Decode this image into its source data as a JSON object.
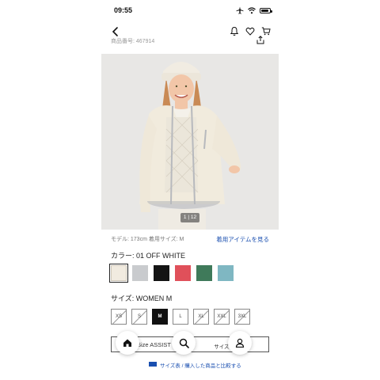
{
  "status_bar": {
    "time": "09:55",
    "icons": [
      "airplane-icon",
      "wifi-icon",
      "battery-icon"
    ]
  },
  "header": {
    "back_icon": "chevron-left-icon",
    "icons": [
      "bell-icon",
      "heart-icon",
      "cart-icon",
      "share-icon"
    ],
    "product_number": "商品番号: 467914"
  },
  "product_image": {
    "description_icon": "product-photo",
    "counter": "1 | 12"
  },
  "model_info": "モデル: 173cm 着用サイズ: M",
  "coordinate_link": "着用アイテムを見る",
  "color": {
    "label": "カラー: 01 OFF WHITE",
    "swatches": [
      {
        "color": "#f1ebe0",
        "selected": true
      },
      {
        "color": "#c9cbce",
        "selected": false
      },
      {
        "color": "#141414",
        "selected": false
      },
      {
        "color": "#e0505a",
        "selected": false
      },
      {
        "color": "#3f7a5a",
        "selected": false
      },
      {
        "color": "#7fb7c2",
        "selected": false
      }
    ]
  },
  "size": {
    "label": "サイズ: WOMEN M",
    "options": [
      {
        "label": "XS",
        "state": "unavailable"
      },
      {
        "label": "S",
        "state": "unavailable"
      },
      {
        "label": "M",
        "state": "selected"
      },
      {
        "label": "L",
        "state": "available"
      },
      {
        "label": "XL",
        "state": "unavailable"
      },
      {
        "label": "XXL",
        "state": "unavailable"
      },
      {
        "label": "3XL",
        "state": "unavailable"
      }
    ]
  },
  "assist_bar": {
    "left_text": "Size ASSIST",
    "right_text": "サイズを確認"
  },
  "floating_nav": {
    "icons": [
      "home-icon",
      "search-icon",
      "account-icon"
    ]
  },
  "size_chart_link": "サイズ表 / 購入した商品と比較する"
}
